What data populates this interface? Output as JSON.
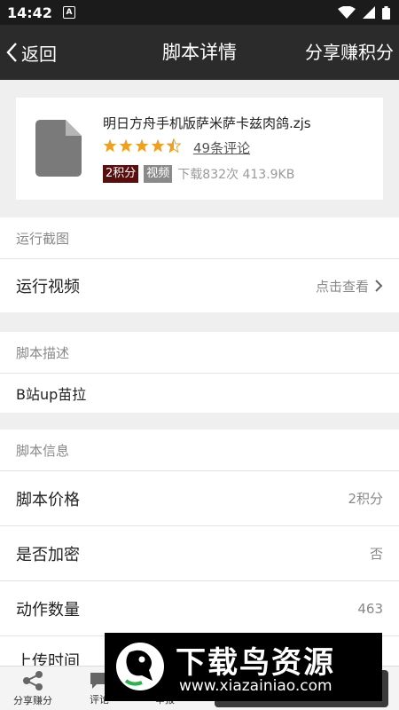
{
  "status_bar": {
    "time": "14:42",
    "notification_glyph": "A"
  },
  "nav": {
    "back_label": "返回",
    "title": "脚本详情",
    "action_label": "分享赚积分"
  },
  "script": {
    "name": "明日方舟手机版萨米萨卡兹肉鸽.zjs",
    "rating": 4.5,
    "rating_max": 5,
    "reviews_label": "49条评论",
    "points_tag": "2积分",
    "video_tag": "视频",
    "download_info": "下载832次 413.9KB"
  },
  "sections": {
    "screenshots_title": "运行截图",
    "video_label": "运行视频",
    "video_action": "点击查看",
    "description_title": "脚本描述",
    "description_text": "B站up苗拉",
    "info_title": "脚本信息",
    "info_rows": [
      {
        "label": "脚本价格",
        "value": "2积分"
      },
      {
        "label": "是否加密",
        "value": "否"
      },
      {
        "label": "动作数量",
        "value": "463"
      },
      {
        "label": "上传时间",
        "value": ""
      }
    ]
  },
  "bottom_bar": {
    "share_label": "分享赚分",
    "comment_label": "评论",
    "report_label": "举报"
  },
  "watermark": {
    "title": "下载鸟资源",
    "url": "www.xiazainiao.com"
  },
  "colors": {
    "navbar": "#2b2b2b",
    "points_tag": "#5a0f0f",
    "star": "#f0a020"
  }
}
